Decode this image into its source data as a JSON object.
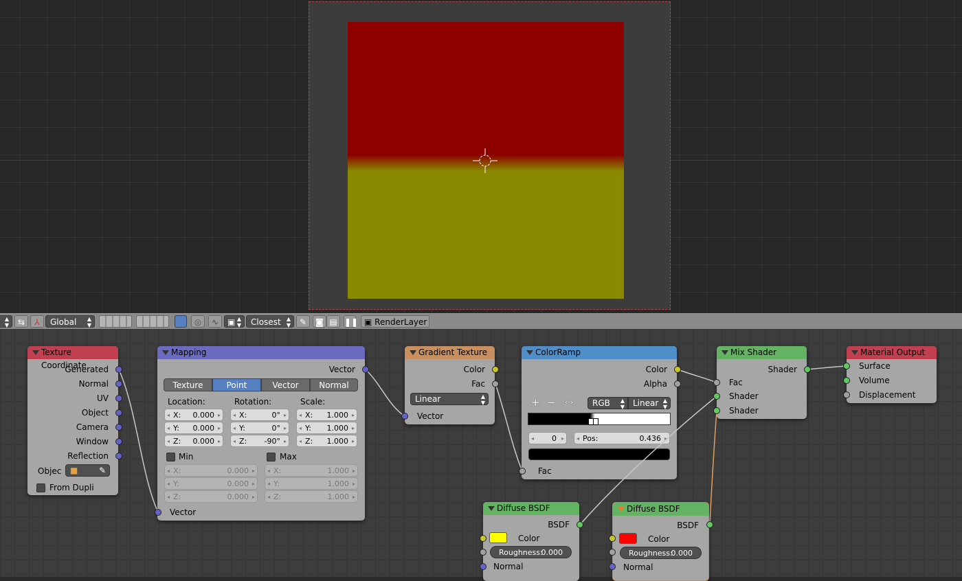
{
  "header": {
    "transform_orientation": "Global",
    "interpolation": "Closest",
    "render_layer": "RenderLayer",
    "icons": [
      "display-mode-icon",
      "view-arrows-icon",
      "manipulator-icon",
      "layers-a-icon",
      "layers-b-icon",
      "snap-icon",
      "proportional-icon",
      "falloff-icon",
      "cube-icon",
      "color-picker-icon",
      "render-still-icon",
      "render-animation-icon",
      "pause-icon",
      "render-layer-icon"
    ]
  },
  "viewer": {
    "render_colors": {
      "top": "#8c0000",
      "bottom": "#8a8a00"
    }
  },
  "nodes": {
    "texture_coordinate": {
      "title": "Texture Coordinate",
      "header_color": "#c0404f",
      "outputs": [
        "Generated",
        "Normal",
        "UV",
        "Object",
        "Camera",
        "Window",
        "Reflection"
      ],
      "object_label": "Objec",
      "from_dupli_label": "From Dupli"
    },
    "mapping": {
      "title": "Mapping",
      "header_color": "#6b6bbf",
      "output": "Vector",
      "input": "Vector",
      "tabs": [
        {
          "label": "Texture",
          "active": false
        },
        {
          "label": "Point",
          "active": true
        },
        {
          "label": "Vector",
          "active": false
        },
        {
          "label": "Normal",
          "active": false
        }
      ],
      "location_label": "Location:",
      "rotation_label": "Rotation:",
      "scale_label": "Scale:",
      "location": [
        {
          "axis": "X:",
          "value": "0.000"
        },
        {
          "axis": "Y:",
          "value": "0.000"
        },
        {
          "axis": "Z:",
          "value": "0.000"
        }
      ],
      "rotation": [
        {
          "axis": "X:",
          "value": "0°"
        },
        {
          "axis": "Y:",
          "value": "0°"
        },
        {
          "axis": "Z:",
          "value": "-90°"
        }
      ],
      "scale": [
        {
          "axis": "X:",
          "value": "1.000"
        },
        {
          "axis": "Y:",
          "value": "1.000"
        },
        {
          "axis": "Z:",
          "value": "1.000"
        }
      ],
      "min_label": "Min",
      "max_label": "Max",
      "min": [
        {
          "axis": "X:",
          "value": "0.000"
        },
        {
          "axis": "Y:",
          "value": "0.000"
        },
        {
          "axis": "Z:",
          "value": "0.000"
        }
      ],
      "max": [
        {
          "axis": "X:",
          "value": "1.000"
        },
        {
          "axis": "Y:",
          "value": "1.000"
        },
        {
          "axis": "Z:",
          "value": "1.000"
        }
      ]
    },
    "gradient_texture": {
      "title": "Gradient Texture",
      "header_color": "#c98f5f",
      "outputs": [
        "Color",
        "Fac"
      ],
      "type": "Linear",
      "input": "Vector"
    },
    "color_ramp": {
      "title": "ColorRamp",
      "header_color": "#4f8fc9",
      "outputs": [
        "Color",
        "Alpha"
      ],
      "color_mode": "RGB",
      "interpolation": "Linear",
      "active_index": "0",
      "pos_label": "Pos:",
      "pos_value": "0.436",
      "stops": [
        {
          "position": 0.436,
          "color": "#000000"
        },
        {
          "position": 0.47,
          "color": "#ffffff"
        }
      ],
      "active_color": "#000000",
      "input": "Fac"
    },
    "mix_shader": {
      "title": "Mix Shader",
      "header_color": "#63b363",
      "output": "Shader",
      "inputs": [
        "Fac",
        "Shader",
        "Shader"
      ]
    },
    "material_output": {
      "title": "Material Output",
      "header_color": "#c0404f",
      "inputs": [
        "Surface",
        "Volume",
        "Displacement"
      ]
    },
    "diffuse_1": {
      "title": "Diffuse BSDF",
      "header_color": "#63b363",
      "output": "BSDF",
      "color_label": "Color",
      "color_value": "#ffff00",
      "roughness_label": "Roughness:",
      "roughness_value": "0.000",
      "normal_label": "Normal"
    },
    "diffuse_2": {
      "title": "Diffuse BSDF",
      "header_color": "#63b363",
      "output": "BSDF",
      "color_label": "Color",
      "color_value": "#ff0000",
      "roughness_label": "Roughness:",
      "roughness_value": "0.000",
      "normal_label": "Normal"
    }
  }
}
